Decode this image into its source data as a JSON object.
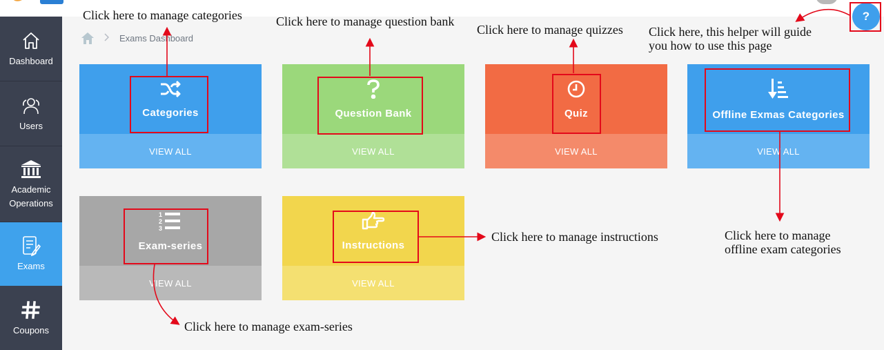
{
  "sidebar": {
    "items": [
      {
        "label": "Dashboard",
        "icon": "home-icon"
      },
      {
        "label": "Users",
        "icon": "users-icon"
      },
      {
        "label": "Academic Operations",
        "icon": "institution-icon"
      },
      {
        "label": "Exams",
        "icon": "exam-paper-icon",
        "active": true
      },
      {
        "label": "Coupons",
        "icon": "hashtag-icon"
      }
    ]
  },
  "breadcrumb": {
    "separator": ">",
    "current": "Exams Dashboard"
  },
  "cards": [
    {
      "title": "Categories",
      "link": "VIEW ALL",
      "icon": "shuffle-icon"
    },
    {
      "title": "Question Bank",
      "link": "VIEW ALL",
      "icon": "question-mark-icon"
    },
    {
      "title": "Quiz",
      "link": "VIEW ALL",
      "icon": "clock-icon"
    },
    {
      "title": "Offline Exmas Categories",
      "link": "VIEW ALL",
      "icon": "sort-down-icon"
    },
    {
      "title": "Exam-series",
      "link": "VIEW ALL",
      "icon": "numbered-list-icon"
    },
    {
      "title": "Instructions",
      "link": "VIEW ALL",
      "icon": "pointing-hand-icon"
    }
  ],
  "help": {
    "label": "?"
  },
  "annotations": {
    "categories": "Click here to manage categories",
    "question_bank": "Click here to manage question bank",
    "quizzes": "Click here to manage quizzes",
    "helper_line1": "Click here, this helper will guide",
    "helper_line2": "you how to use this page",
    "instructions": "Click here to manage instructions",
    "offline_line1": "Click here to manage",
    "offline_line2": "offline exam categories",
    "exam_series": "Click here to manage exam-series"
  },
  "colors": {
    "sidebar_bg": "#3b4150",
    "sidebar_active": "#3fa2ec",
    "blue": "#3f9fec",
    "green": "#9bd87b",
    "orange": "#f26b44",
    "gray": "#a7a7a7",
    "yellow": "#f2d64d",
    "annotation_red": "#e3091a"
  }
}
